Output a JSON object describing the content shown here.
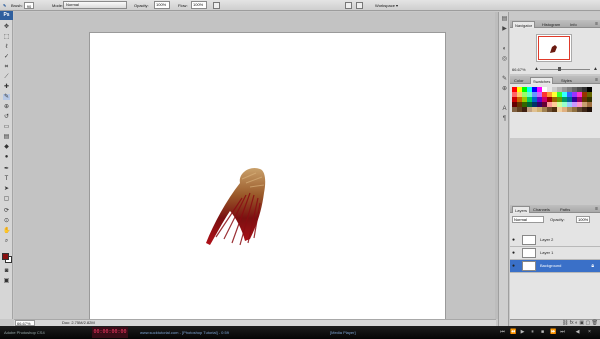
{
  "options_bar": {
    "brush_label": "Brush:",
    "brush_size": "90",
    "mode_label": "Mode:",
    "mode_value": "Normal",
    "opacity_label": "Opacity:",
    "opacity_value": "100%",
    "flow_label": "Flow:",
    "flow_value": "100%",
    "workspace_label": "Workspace ▾"
  },
  "ps_logo": "Ps",
  "tools": [
    "move",
    "marquee",
    "lasso",
    "quick-select",
    "crop",
    "eyedropper",
    "healing",
    "brush",
    "clone",
    "history-brush",
    "eraser",
    "gradient",
    "blur",
    "dodge",
    "pen",
    "type",
    "path-select",
    "shape",
    "3d-rotate",
    "3d-orbit",
    "hand",
    "zoom"
  ],
  "colors": {
    "foreground": "#8a1010",
    "background": "#ffffff",
    "accent": "#3a70c8"
  },
  "status": {
    "zoom": "66.67%",
    "doc": "Doc: 2.75M/2.82M"
  },
  "panels": {
    "top_tabs": [
      "Navigator",
      "Histogram",
      "Info"
    ],
    "navigator_zoom": "66.67%",
    "mid_tabs": [
      "Color",
      "Swatches",
      "Styles"
    ],
    "layers_tabs": [
      "Layers",
      "Channels",
      "Paths"
    ],
    "layers_blend": "Normal",
    "layers_opacity_label": "Opacity:",
    "layers_opacity_value": "100%",
    "layers": [
      {
        "name": "Layer 2",
        "selected": false
      },
      {
        "name": "Layer 1",
        "selected": false
      },
      {
        "name": "Background",
        "selected": true
      }
    ]
  },
  "swatches": [
    "#ff0000",
    "#ffff00",
    "#00ff00",
    "#00ffff",
    "#0000ff",
    "#ff00ff",
    "#ffffff",
    "#e6e6e6",
    "#cccccc",
    "#b3b3b3",
    "#999999",
    "#808080",
    "#666666",
    "#4d4d4d",
    "#333333",
    "#000000",
    "#ff6666",
    "#ffcc66",
    "#99ff66",
    "#66ffcc",
    "#6699ff",
    "#cc66ff",
    "#ff3333",
    "#ff9933",
    "#ffff33",
    "#33ff33",
    "#33ffff",
    "#3366ff",
    "#9933ff",
    "#ff33cc",
    "#993300",
    "#666600",
    "#cc0000",
    "#cc6600",
    "#99cc00",
    "#00cc66",
    "#0066cc",
    "#6600cc",
    "#cc0066",
    "#990000",
    "#996600",
    "#669900",
    "#009966",
    "#006699",
    "#330099",
    "#990066",
    "#663300",
    "#333300",
    "#660000",
    "#663300",
    "#336600",
    "#006633",
    "#003366",
    "#330066",
    "#660033",
    "#ff9999",
    "#ffcc99",
    "#ccff99",
    "#99ffcc",
    "#99ccff",
    "#cc99ff",
    "#ff99cc",
    "#c8a070",
    "#a07040",
    "#806040",
    "#604020",
    "#402010",
    "#c0a080",
    "#e0c090",
    "#d0b070",
    "#a08050",
    "#705030",
    "#503010",
    "#f0d0a0",
    "#e0b080",
    "#b09060",
    "#907040",
    "#604830",
    "#402818",
    "#201008"
  ],
  "taskbar": {
    "left_text": "Adobe Photoshop CS4",
    "clock": "00:00:00:00",
    "middle_text": "www.sucktutorial.com - [Photoshop Tutorial] - 0:59",
    "right_text": "[Media Player]"
  }
}
